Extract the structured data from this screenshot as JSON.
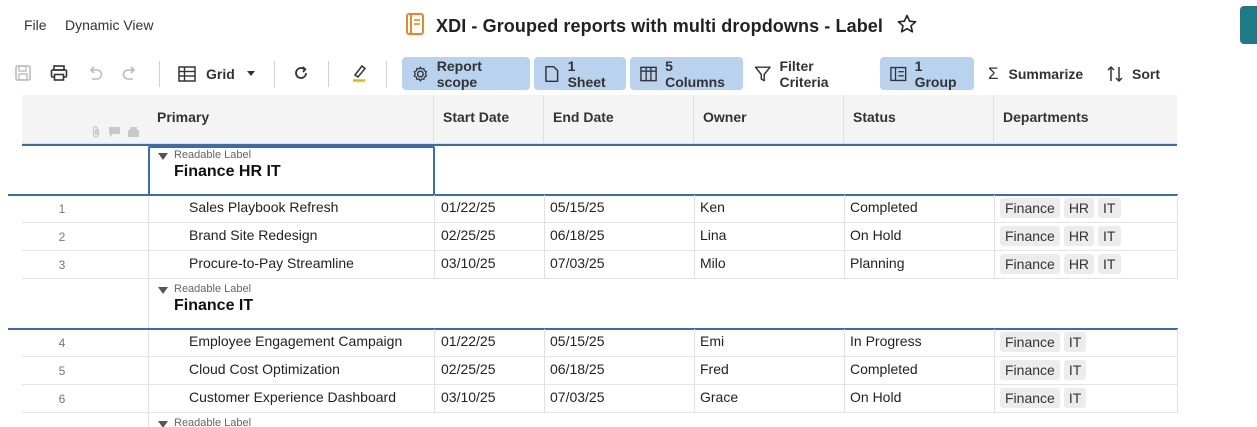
{
  "menu": {
    "file": "File",
    "dynamic_view": "Dynamic View"
  },
  "title": "XDI - Grouped reports with multi dropdowns - Label",
  "toolbar": {
    "grid_label": "Grid",
    "report_scope": "Report scope",
    "sheets": "1 Sheet",
    "columns": "5 Columns",
    "filter": "Filter Criteria",
    "group": "1 Group",
    "summarize": "Summarize",
    "sort": "Sort"
  },
  "headers": {
    "primary": "Primary",
    "start": "Start Date",
    "end": "End Date",
    "owner": "Owner",
    "status": "Status",
    "departments": "Departments"
  },
  "group_label_caption": "Readable Label",
  "groups": [
    {
      "title": "Finance HR IT",
      "rows": [
        {
          "num": "1",
          "primary": "Sales Playbook Refresh",
          "start": "01/22/25",
          "end": "05/15/25",
          "owner": "Ken",
          "status": "Completed",
          "depts": [
            "Finance",
            "HR",
            "IT"
          ]
        },
        {
          "num": "2",
          "primary": "Brand Site Redesign",
          "start": "02/25/25",
          "end": "06/18/25",
          "owner": "Lina",
          "status": "On Hold",
          "depts": [
            "Finance",
            "HR",
            "IT"
          ]
        },
        {
          "num": "3",
          "primary": "Procure-to-Pay Streamline",
          "start": "03/10/25",
          "end": "07/03/25",
          "owner": "Milo",
          "status": "Planning",
          "depts": [
            "Finance",
            "HR",
            "IT"
          ]
        }
      ]
    },
    {
      "title": "Finance IT",
      "rows": [
        {
          "num": "4",
          "primary": "Employee Engagement Campaign",
          "start": "01/22/25",
          "end": "05/15/25",
          "owner": "Emi",
          "status": "In Progress",
          "depts": [
            "Finance",
            "IT"
          ]
        },
        {
          "num": "5",
          "primary": "Cloud Cost Optimization",
          "start": "02/25/25",
          "end": "06/18/25",
          "owner": "Fred",
          "status": "Completed",
          "depts": [
            "Finance",
            "IT"
          ]
        },
        {
          "num": "6",
          "primary": "Customer Experience Dashboard",
          "start": "03/10/25",
          "end": "07/03/25",
          "owner": "Grace",
          "status": "On Hold",
          "depts": [
            "Finance",
            "IT"
          ]
        }
      ]
    }
  ],
  "colors": {
    "accent": "#1e7a87",
    "active_button": "#b9d3ef",
    "group_line": "#3a6db0"
  }
}
